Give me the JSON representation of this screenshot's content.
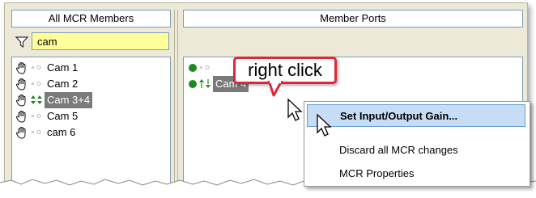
{
  "left_panel": {
    "header": "All MCR Members",
    "filter_value": "cam",
    "members": [
      {
        "label": "Cam 1",
        "selected": false,
        "icon": "hand-icon",
        "state": "inactive"
      },
      {
        "label": "Cam 2",
        "selected": false,
        "icon": "hand-icon",
        "state": "inactive"
      },
      {
        "label": "Cam 3+4",
        "selected": true,
        "icon": "hand-icon",
        "state": "active"
      },
      {
        "label": "Cam 5",
        "selected": false,
        "icon": "hand-icon",
        "state": "inactive"
      },
      {
        "label": "cam 6",
        "selected": false,
        "icon": "hand-icon",
        "state": "inactive"
      }
    ]
  },
  "right_panel": {
    "header": "Member Ports",
    "ports": [
      {
        "label": "",
        "selected": false,
        "state": "inactive"
      },
      {
        "label": "Cam 4",
        "selected": true,
        "state": "active"
      }
    ]
  },
  "callout": {
    "text": "right click",
    "color": "#e0273a"
  },
  "context_menu": {
    "items": [
      {
        "label": "Set Input/Output Gain...",
        "active": true
      },
      {
        "label": "Discard all MCR changes",
        "active": false
      },
      {
        "label": "MCR Properties",
        "active": false
      }
    ]
  },
  "colors": {
    "window_bg": "#ece9d8",
    "filter_bg": "#ffff99",
    "selection": "#7a7a7a",
    "menu_highlight": "#c6ddf5",
    "status_green": "#1e8a1e"
  }
}
